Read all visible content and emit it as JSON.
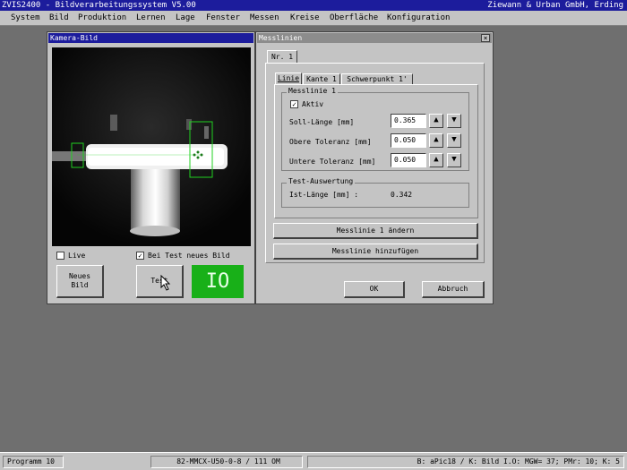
{
  "app": {
    "title": "ZVIS2400 - Bildverarbeitungssystem V5.00",
    "company": "Ziewann & Urban GmbH, Erding"
  },
  "menu": [
    "System",
    "Bild",
    "Produktion",
    "Lernen",
    "Lage",
    "Fenster",
    "Messen",
    "Kreise",
    "Oberfläche",
    "Konfiguration"
  ],
  "camera_window": {
    "title": "Kamera-Bild",
    "live_label": "Live",
    "live_checked": false,
    "test_new_image_label": "Bei Test neues Bild",
    "test_new_image_checked": true,
    "new_image_button": "Neues\nBild",
    "test_button": "Test",
    "result": "IO",
    "result_color": "#18b018"
  },
  "mess_window": {
    "title": "Messlinien",
    "outer_tab": "Nr. 1",
    "tabs": [
      "Linie",
      "Kante 1",
      "Schwerpunkt 1'"
    ],
    "group_title": "Messlinie 1",
    "aktiv_label": "Aktiv",
    "aktiv_checked": true,
    "soll_label": "Soll-Länge [mm]",
    "soll_value": "0.365",
    "obere_label": "Obere  Toleranz [mm]",
    "obere_value": "0.050",
    "untere_label": "Untere Toleranz [mm]",
    "untere_value": "0.050",
    "test_group_title": "Test-Auswertung",
    "ist_label": "Ist-Länge [mm]   :",
    "ist_value": "0.342",
    "change_button": "Messlinie 1 ändern",
    "add_button": "Messlinie hinzufügen",
    "ok_button": "OK",
    "cancel_button": "Abbruch",
    "close_glyph": "×",
    "up_glyph": "▲",
    "down_glyph": "▼",
    "check_glyph": "✓"
  },
  "status": {
    "program": "Programm 10",
    "part": "82-MMCX-U50-0-8 / 111 OM",
    "info": "B: aPic18 / K: Bild I.O: MGW= 37; PMr: 10; K: 5"
  }
}
